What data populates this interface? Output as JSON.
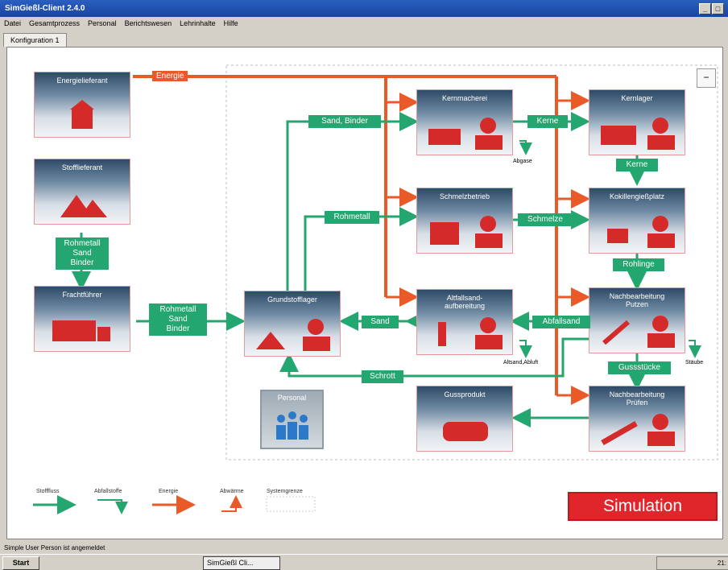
{
  "window": {
    "title": "SimGießl-Client 2.4.0",
    "buttons": [
      "_",
      "□"
    ]
  },
  "menu": [
    "Datei",
    "Gesamtprozess",
    "Personal",
    "Berichtswesen",
    "Lehrinhalte",
    "Hilfe"
  ],
  "tab": "Konfiguration 1",
  "minimize_label": "−",
  "nodes": {
    "energielieferant": "Energielieferant",
    "stofflieferant": "Stofflieferant",
    "frachtfuehrer": "Frachtführer",
    "grundstofflager": "Grundstofflager",
    "kernmacherei": "Kernmacherei",
    "schmelzbetrieb": "Schmelzbetrieb",
    "altsand": "Altfallsand-\naufbereitung",
    "kernlager": "Kernlager",
    "kokillengiessplatz": "Kokillengießplatz",
    "nachbearbeitung_putzen": "Nachbearbeitung\nPutzen",
    "nachbearbeitung_pruefen": "Nachbearbeitung\nPrüfen",
    "gussprodukt": "Gussprodukt",
    "personal": "Personal"
  },
  "flows": {
    "energie": "Energie",
    "rohmetall_sand_binder_1": "Rohmetall\nSand\nBinder",
    "rohmetall_sand_binder_2": "Rohmetall\nSand\nBinder",
    "sand_binder": "Sand, Binder",
    "rohmetall": "Rohmetall",
    "sand": "Sand",
    "kerne_1": "Kerne",
    "kerne_2": "Kerne",
    "schmelze": "Schmelze",
    "rohlinge": "Rohlinge",
    "abfallsand": "Abfallsand",
    "gussstuecke": "Gussstücke",
    "schrott": "Schrott"
  },
  "small_labels": {
    "abgase": "Abgase",
    "altsand_abluft": "Altsand,Abluft",
    "staube": "Stäube"
  },
  "legend": {
    "stofffluss": "Stofffluss",
    "abfallstoffe": "Abfallstoffe",
    "energie": "Energie",
    "abwaerme": "Abwärme",
    "systemgrenze": "Systemgrenze"
  },
  "simulation_button": "Simulation",
  "status": "Simple User Person ist angemeldet",
  "taskbar": {
    "start": "Start",
    "task": "SimGießl Cli...",
    "clock": "21:"
  },
  "colors": {
    "flow": "#23a66f",
    "energy": "#ea5a29",
    "accent": "#e0262a"
  }
}
